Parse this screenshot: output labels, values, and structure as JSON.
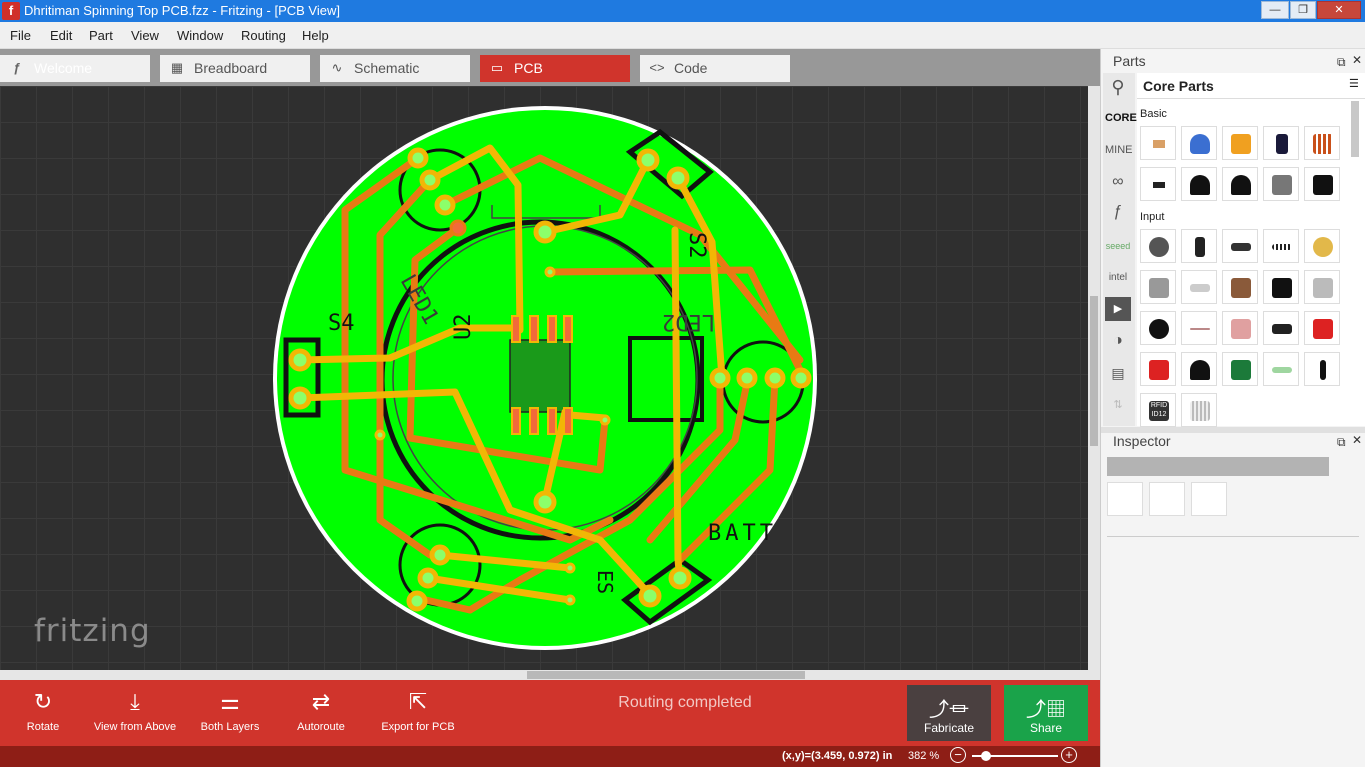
{
  "window": {
    "title": "Dhritiman Spinning Top PCB.fzz - Fritzing - [PCB View]",
    "logo_letter": "f",
    "controls": [
      "—",
      "❐",
      "✕"
    ]
  },
  "menu": [
    "File",
    "Edit",
    "Part",
    "View",
    "Window",
    "Routing",
    "Help"
  ],
  "tabs": [
    {
      "label": "Welcome",
      "icon": "fritzing-icon"
    },
    {
      "label": "Breadboard",
      "icon": "breadboard-icon"
    },
    {
      "label": "Schematic",
      "icon": "schematic-icon"
    },
    {
      "label": "PCB",
      "icon": "pcb-icon",
      "active": true
    },
    {
      "label": "Code",
      "icon": "code-icon"
    }
  ],
  "canvas": {
    "watermark": "fritzing",
    "board_color": "#00ff00",
    "trace_orange": "#e87a14",
    "trace_yellow": "#f2b705",
    "silkscreen": {
      "s4": "S4",
      "s2": "S2",
      "u2": "U2",
      "led1": "LED1",
      "led2": "LED2",
      "batt": "BATT",
      "es": "ES"
    }
  },
  "toolbar": {
    "rotate": "Rotate",
    "view_from_above": "View from Above",
    "both_layers": "Both Layers",
    "autoroute": "Autoroute",
    "export_for_pcb": "Export for PCB",
    "status": "Routing completed",
    "fabricate": "Fabricate",
    "share": "Share"
  },
  "statusbar": {
    "coords": "(x,y)=(3.459, 0.972) in",
    "zoom": "382 %",
    "zoom_out": "−",
    "zoom_in": "+"
  },
  "parts_panel": {
    "title": "Parts",
    "bin_title": "Core Parts",
    "sections": [
      "Basic",
      "Input"
    ],
    "bins": [
      "CORE",
      "MINE"
    ],
    "rfid_label": "RFID\nID12"
  },
  "inspector": {
    "title": "Inspector"
  }
}
